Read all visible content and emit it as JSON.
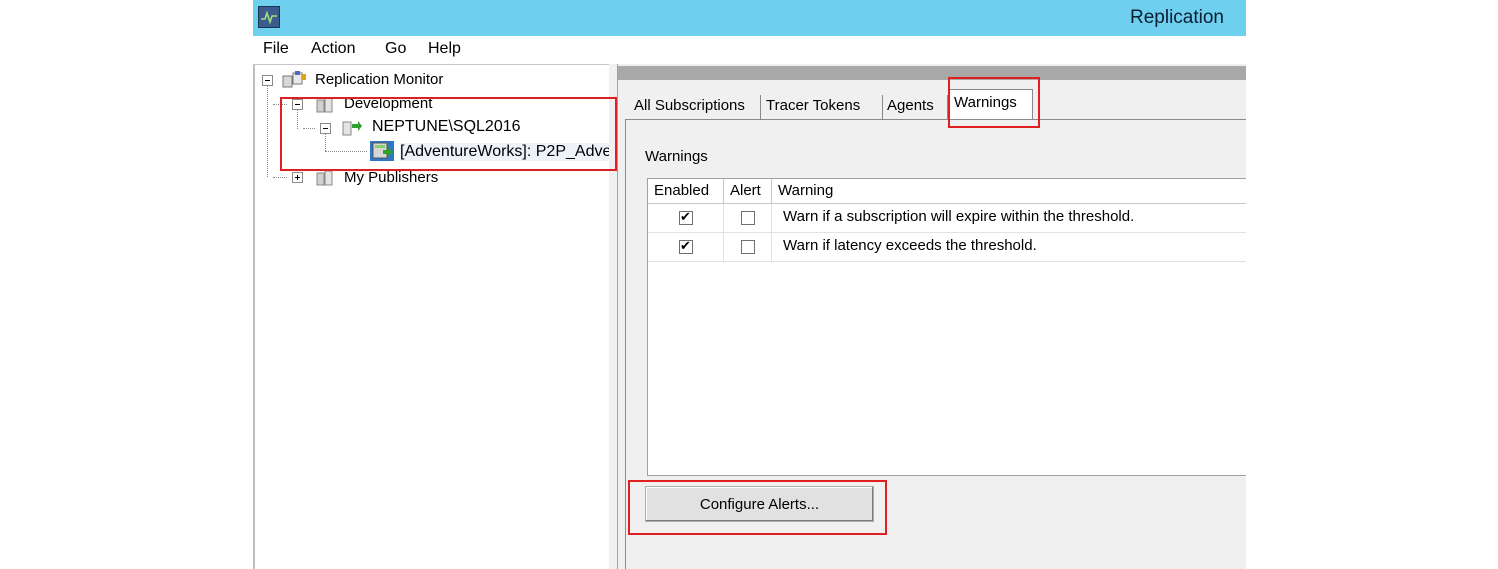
{
  "window": {
    "title": "Replication",
    "icon": "replication-monitor-icon"
  },
  "menu": [
    "File",
    "Action",
    "Go",
    "Help"
  ],
  "tree": {
    "root": "Replication Monitor",
    "groups": [
      {
        "label": "Development",
        "server": "NEPTUNE\\SQL2016",
        "publication": "[AdventureWorks]: P2P_Adve"
      },
      {
        "label": "My Publishers"
      }
    ]
  },
  "tabs": [
    "All Subscriptions",
    "Tracer Tokens",
    "Agents",
    "Warnings"
  ],
  "active_tab": "Warnings",
  "warnings_panel": {
    "group_label": "Warnings",
    "columns": [
      "Enabled",
      "Alert",
      "Warning"
    ],
    "rows": [
      {
        "enabled": true,
        "alert": false,
        "warning": "Warn if a subscription will expire within the threshold."
      },
      {
        "enabled": true,
        "alert": false,
        "warning": "Warn if latency exceeds the threshold."
      }
    ],
    "configure_button": "Configure Alerts..."
  },
  "highlight_color": "#e02020",
  "titlebar_color": "#6ecfee"
}
